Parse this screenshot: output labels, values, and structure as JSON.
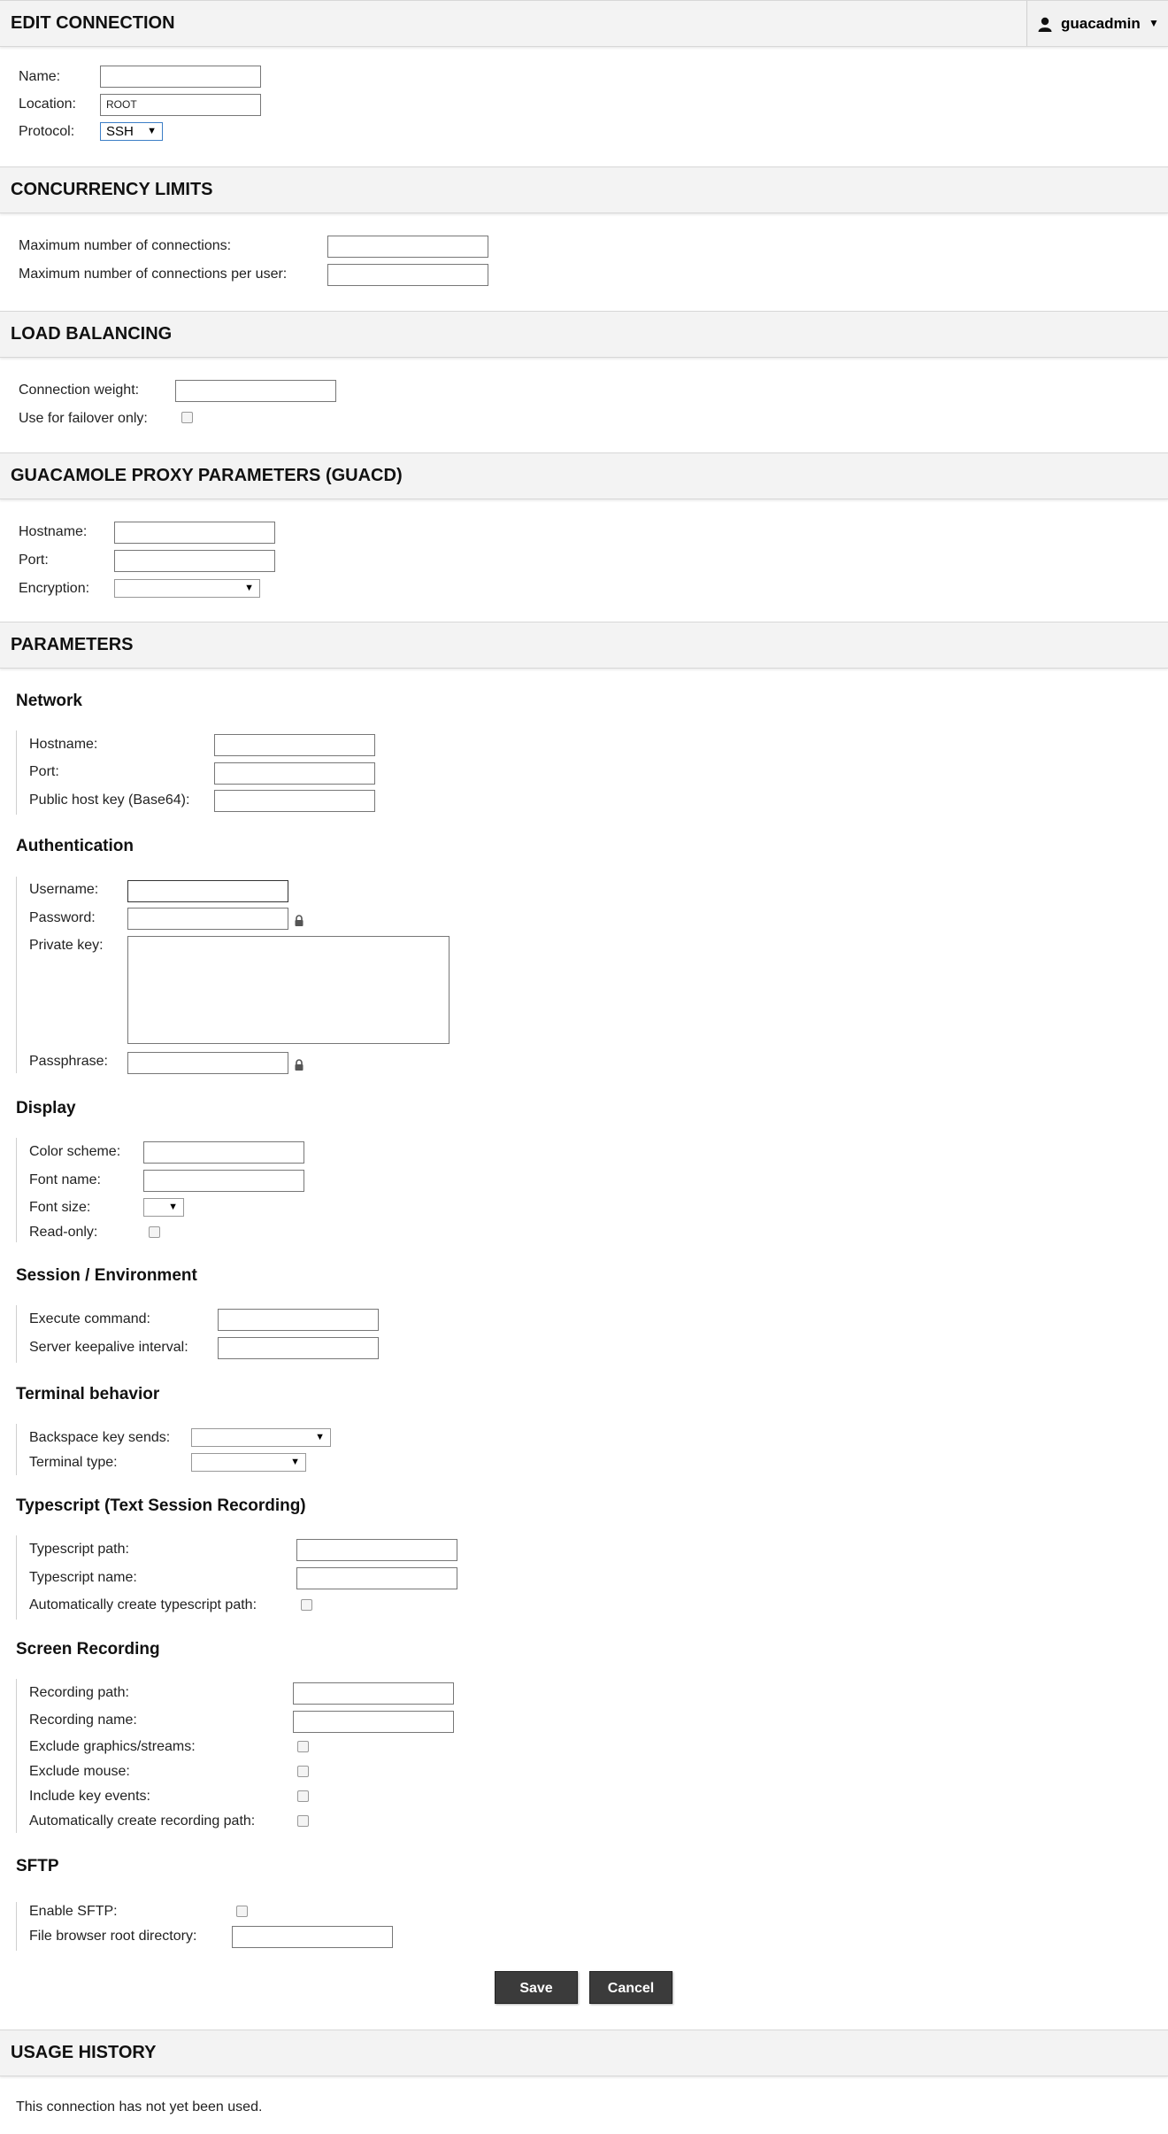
{
  "user_menu": {
    "username": "guacadmin"
  },
  "edit_connection": {
    "title": "EDIT CONNECTION",
    "name_label": "Name:",
    "name_value": "",
    "location_label": "Location:",
    "location_value": "ROOT",
    "protocol_label": "Protocol:",
    "protocol_value": "SSH"
  },
  "concurrency": {
    "title": "CONCURRENCY LIMITS",
    "max_connections_label": "Maximum number of connections:",
    "max_connections_per_user_label": "Maximum number of connections per user:"
  },
  "load_balancing": {
    "title": "LOAD BALANCING",
    "weight_label": "Connection weight:",
    "failover_label": "Use for failover only:"
  },
  "proxy": {
    "title": "GUACAMOLE PROXY PARAMETERS (GUACD)",
    "hostname_label": "Hostname:",
    "port_label": "Port:",
    "encryption_label": "Encryption:"
  },
  "parameters": {
    "title": "PARAMETERS",
    "network": {
      "title": "Network",
      "hostname_label": "Hostname:",
      "port_label": "Port:",
      "host_key_label": "Public host key (Base64):"
    },
    "authentication": {
      "title": "Authentication",
      "username_label": "Username:",
      "password_label": "Password:",
      "private_key_label": "Private key:",
      "passphrase_label": "Passphrase:"
    },
    "display": {
      "title": "Display",
      "color_scheme_label": "Color scheme:",
      "font_name_label": "Font name:",
      "font_size_label": "Font size:",
      "read_only_label": "Read-only:"
    },
    "session": {
      "title": "Session / Environment",
      "execute_command_label": "Execute command:",
      "keepalive_label": "Server keepalive interval:"
    },
    "terminal": {
      "title": "Terminal behavior",
      "backspace_label": "Backspace key sends:",
      "terminal_type_label": "Terminal type:"
    },
    "typescript": {
      "title": "Typescript (Text Session Recording)",
      "path_label": "Typescript path:",
      "name_label": "Typescript name:",
      "auto_create_label": "Automatically create typescript path:"
    },
    "recording": {
      "title": "Screen Recording",
      "path_label": "Recording path:",
      "name_label": "Recording name:",
      "exclude_graphics_label": "Exclude graphics/streams:",
      "exclude_mouse_label": "Exclude mouse:",
      "include_keys_label": "Include key events:",
      "auto_create_label": "Automatically create recording path:"
    },
    "sftp": {
      "title": "SFTP",
      "enable_label": "Enable SFTP:",
      "root_dir_label": "File browser root directory:"
    }
  },
  "buttons": {
    "save": "Save",
    "cancel": "Cancel"
  },
  "usage_history": {
    "title": "USAGE HISTORY",
    "empty_message": "This connection has not yet been used."
  },
  "icons": {
    "user": "user-icon",
    "lock": "lock-icon",
    "caret": "caret-down-icon"
  }
}
